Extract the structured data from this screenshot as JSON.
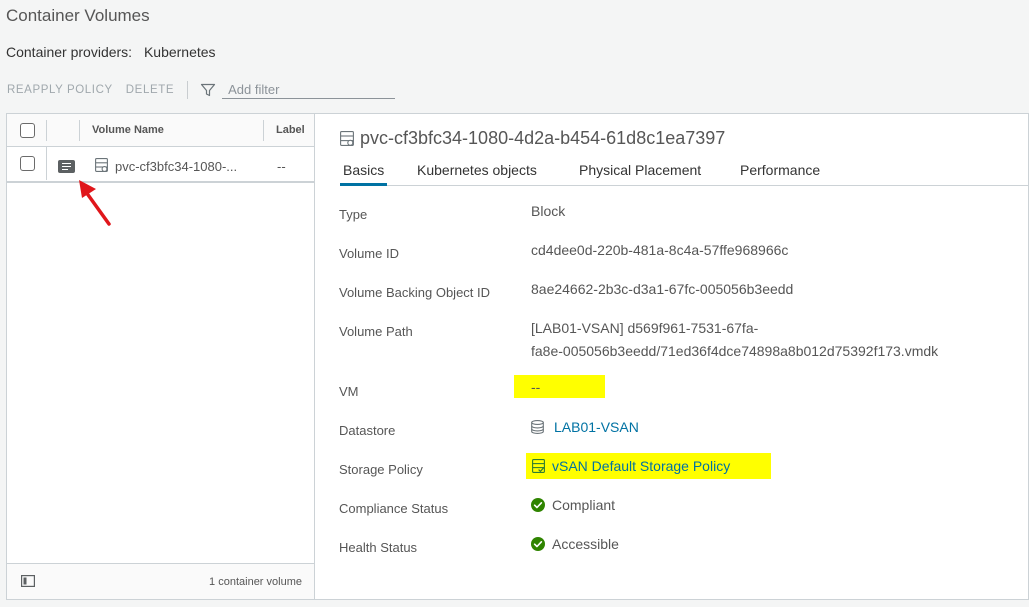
{
  "page": {
    "title": "Container Volumes",
    "providers_label": "Container providers:",
    "providers_value": "Kubernetes"
  },
  "toolbar": {
    "reapply_label": "REAPPLY POLICY",
    "delete_label": "DELETE",
    "filter_placeholder": "Add filter"
  },
  "grid": {
    "columns": [
      "Volume Name",
      "Label"
    ],
    "rows": [
      {
        "name": "pvc-cf3bfc34-1080-...",
        "label": "--"
      }
    ],
    "footer": "1 container volume"
  },
  "detail": {
    "title": "pvc-cf3bfc34-1080-4d2a-b454-61d8c1ea7397",
    "tabs": [
      "Basics",
      "Kubernetes objects",
      "Physical Placement",
      "Performance"
    ],
    "active_tab": "Basics",
    "props": {
      "type": {
        "label": "Type",
        "value": "Block"
      },
      "volume_id": {
        "label": "Volume ID",
        "value": "cd4dee0d-220b-481a-8c4a-57ffe968966c"
      },
      "backing_id": {
        "label": "Volume Backing Object ID",
        "value": "8ae24662-2b3c-d3a1-67fc-005056b3eedd"
      },
      "volume_path": {
        "label": "Volume Path",
        "line1": "[LAB01-VSAN] d569f961-7531-67fa-",
        "line2": "fa8e-005056b3eedd/71ed36f4dce74898a8b012d75392f173.vmdk"
      },
      "vm": {
        "label": "VM",
        "value": "--"
      },
      "datastore": {
        "label": "Datastore",
        "value": "LAB01-VSAN"
      },
      "storage_policy": {
        "label": "Storage Policy",
        "value": "vSAN Default Storage Policy"
      },
      "compliance": {
        "label": "Compliance Status",
        "value": "Compliant"
      },
      "health": {
        "label": "Health Status",
        "value": "Accessible"
      }
    }
  },
  "colors": {
    "accent": "#0072a3",
    "highlight": "#ffff00",
    "success": "#2f8400",
    "annotation_arrow": "#e0161b"
  }
}
